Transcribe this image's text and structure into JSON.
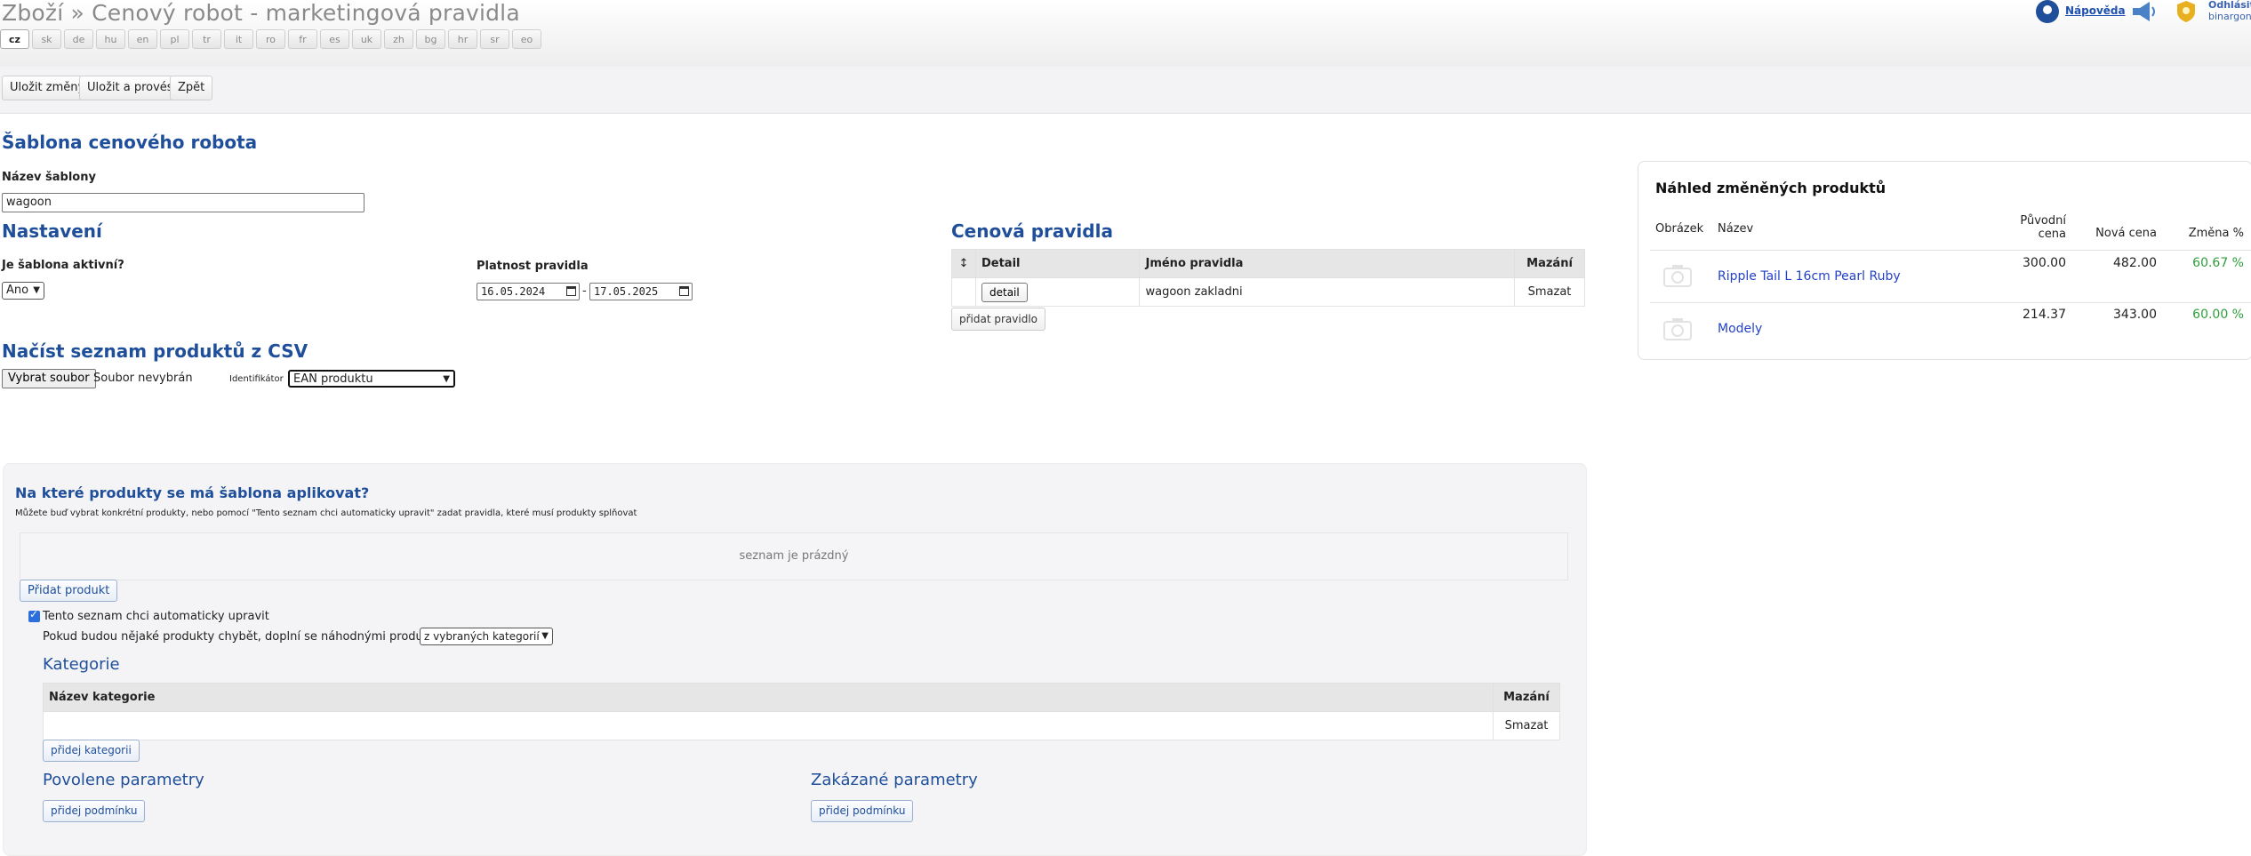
{
  "header": {
    "title": "Zboží » Cenový robot - marketingová pravidla",
    "languages": [
      "cz",
      "sk",
      "de",
      "hu",
      "en",
      "pl",
      "tr",
      "it",
      "ro",
      "fr",
      "es",
      "uk",
      "zh",
      "bg",
      "hr",
      "sr",
      "eo"
    ],
    "help_label": "Nápověda",
    "logout_label": "Odhlásit",
    "user": "binargon"
  },
  "toolbar": {
    "save_label": "Uložit změny",
    "save_run_label": "Uložit a provést",
    "back_label": "Zpět"
  },
  "template": {
    "heading": "Šablona cenového robota",
    "name_label": "Název šablony",
    "name_value": "wagoon"
  },
  "settings": {
    "heading": "Nastavení",
    "active_label": "Je šablona aktivní?",
    "active_value": "Ano",
    "validity_label": "Platnost pravidla",
    "date_from": "16.05.2024",
    "date_separator": "-",
    "date_to": "17.05.2025"
  },
  "csv": {
    "heading": "Načíst seznam produktů z CSV",
    "choose_file_label": "Vybrat soubor",
    "no_file_label": "Soubor nevybrán",
    "identifier_label": "Identifikátor",
    "identifier_value": "EAN produktu"
  },
  "rules": {
    "heading": "Cenová pravidla",
    "columns": {
      "sort": "↕",
      "detail": "Detail",
      "name": "Jméno pravidla",
      "delete": "Mazání"
    },
    "rows": [
      {
        "detail_label": "detail",
        "name": "wagoon zakladni",
        "delete_label": "Smazat"
      }
    ],
    "add_label": "přidat pravidlo"
  },
  "apply": {
    "heading": "Na které produkty se má šablona aplikovat?",
    "description": "Můžete buď vybrat konkrétní produkty, nebo pomocí \"Tento seznam chci automaticky upravit\" zadat pravidla, které musí produkty splňovat",
    "empty_list": "seznam je prázdný",
    "add_product_label": "Přidat produkt",
    "auto_label": "Tento seznam chci automaticky upravit",
    "fill_label": "Pokud budou nějaké produkty chybět, doplní se náhodnými produkty",
    "fill_value": "z vybraných kategorií",
    "category_heading": "Kategorie",
    "category_columns": {
      "name": "Název kategorie",
      "delete": "Mazání"
    },
    "category_rows": [
      {
        "name": "",
        "delete_label": "Smazat"
      }
    ],
    "add_category_label": "přidej kategorii",
    "allowed_heading": "Povolene parametry",
    "forbidden_heading": "Zakázané parametry",
    "add_condition_label": "přidej podmínku"
  },
  "preview": {
    "heading": "Náhled změněných produktů",
    "columns": {
      "image": "Obrázek",
      "name": "Název",
      "orig_price_1": "Původní",
      "orig_price_2": "cena",
      "new_price": "Nová cena",
      "change": "Změna %"
    },
    "rows": [
      {
        "name": "Ripple Tail L 16cm Pearl Ruby",
        "orig": "300.00",
        "new": "482.00",
        "change": "60.67 %"
      },
      {
        "name": "Modely",
        "orig": "214.37",
        "new": "343.00",
        "change": "60.00 %"
      }
    ]
  },
  "colors": {
    "accent": "#1f4f9a",
    "link": "#2442c8",
    "positive": "#2e9e3a"
  }
}
